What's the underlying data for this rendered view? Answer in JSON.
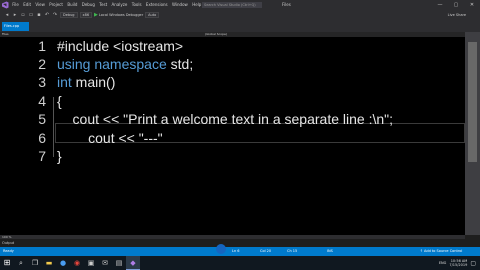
{
  "titlebar": {
    "menu": [
      "File",
      "Edit",
      "View",
      "Project",
      "Build",
      "Debug",
      "Test",
      "Analyze",
      "Tools",
      "Extensions",
      "Window",
      "Help"
    ],
    "search_placeholder": "Search Visual Studio (Ctrl+Q)",
    "doc_title": "Files",
    "minimize": "—",
    "maximize": "▢",
    "close": "✕"
  },
  "toolbar": {
    "config": "Debug",
    "platform": "x86",
    "run_label": "Local Windows Debugger",
    "run_mode": "Auto",
    "live_share": "Live Share"
  },
  "tabs": {
    "file_tab": "Files.cpp"
  },
  "navbar": {
    "left": "Files",
    "right": "(Global Scope)"
  },
  "editor": {
    "line_numbers": [
      "1",
      "2",
      "3",
      "4",
      "5",
      "6",
      "7"
    ],
    "lines": {
      "l1_text": "#include <iostream>",
      "l2_kw1": "using",
      "l2_kw2": "namespace",
      "l2_rest": " std;",
      "l3_kw": "int",
      "l3_rest": " main()",
      "l4": "{",
      "l5": "    cout << \"Print a welcome text in a separate line :\\n\";",
      "l6": "        cout << \"---\"",
      "l7": "}"
    }
  },
  "zoom": "100 %",
  "output_tab": "Output",
  "statusbar": {
    "ready": "Ready",
    "ln": "Ln 6",
    "col": "Col 20",
    "ch": "Ch 15",
    "ins": "INS",
    "source_control": "↑ Add to Source Control"
  },
  "taskbar": {
    "lang": "ENG",
    "time": "10:56 AM",
    "date": "7/15/2019"
  }
}
